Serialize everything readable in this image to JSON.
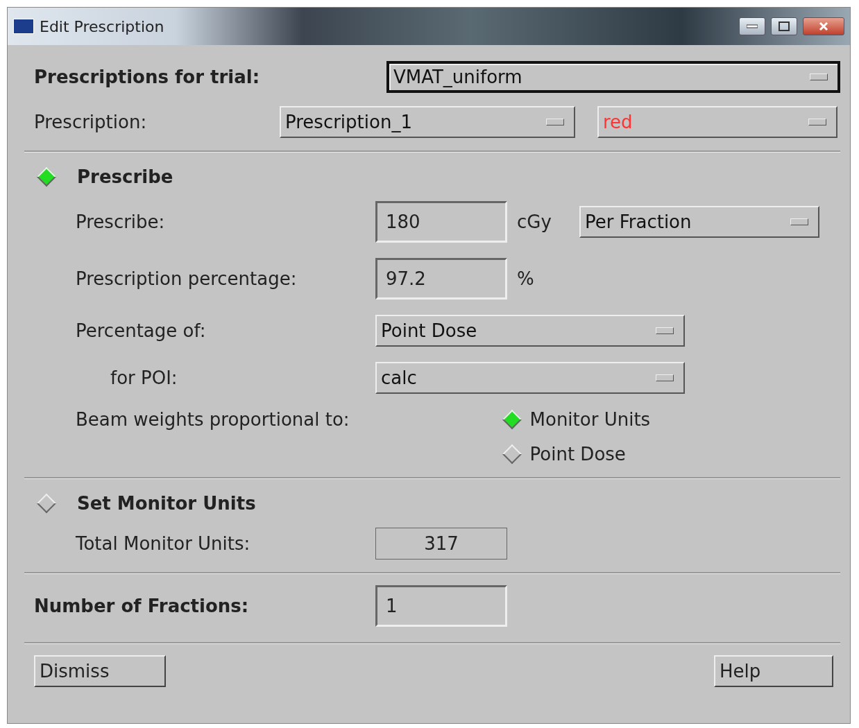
{
  "window": {
    "title": "Edit Prescription"
  },
  "trial": {
    "label": "Prescriptions for trial:",
    "value": "VMAT_uniform"
  },
  "prescription": {
    "label": "Prescription:",
    "value": "Prescription_1",
    "color_value": "red",
    "color": "#ff3333"
  },
  "sections": [
    {
      "label": "Prescribe",
      "selected": true,
      "rows": [
        {
          "kind": "field",
          "label": "Prescribe:",
          "value": "180",
          "unit": "cGy",
          "menu": "Per Fraction"
        },
        {
          "kind": "field",
          "label": "Prescription percentage:",
          "value": "97.2",
          "unit": "%"
        },
        {
          "kind": "menu",
          "label": "Percentage of:",
          "value": "Point Dose"
        },
        {
          "kind": "submenu",
          "label": "for POI:",
          "value": "calc"
        },
        {
          "kind": "radios",
          "label": "Beam weights proportional to:",
          "options": [
            {
              "label": "Monitor Units",
              "selected": true
            },
            {
              "label": "Point Dose",
              "selected": false
            }
          ]
        }
      ]
    },
    {
      "label": "Set Monitor Units",
      "selected": false,
      "rows": [
        {
          "kind": "readonly",
          "label": "Total Monitor Units:",
          "value": "317"
        }
      ]
    }
  ],
  "fractions": {
    "label": "Number of Fractions:",
    "value": "1"
  },
  "buttons": [
    {
      "label": "Dismiss"
    },
    {
      "label": "Help"
    }
  ]
}
